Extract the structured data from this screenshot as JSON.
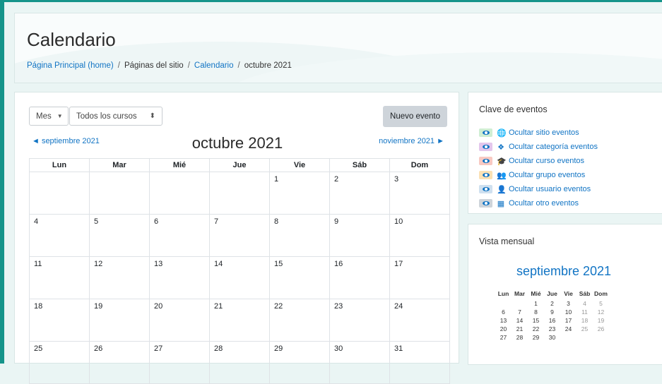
{
  "header": {
    "title": "Calendario",
    "breadcrumb": {
      "home": "Página Principal (home)",
      "sitio": "Páginas del sitio",
      "calendario": "Calendario",
      "current": "octubre 2021",
      "separator": "/"
    }
  },
  "toolbar": {
    "view_select": "Mes",
    "course_select": "Todos los cursos",
    "new_event": "Nuevo evento"
  },
  "calendar": {
    "prev_month": "◄  septiembre 2021",
    "next_month": "noviembre 2021  ►",
    "month_title": "octubre 2021",
    "weekdays": [
      "Lun",
      "Mar",
      "Mié",
      "Jue",
      "Vie",
      "Sáb",
      "Dom"
    ],
    "weeks": [
      [
        "",
        "",
        "",
        "",
        "1",
        "2",
        "3"
      ],
      [
        "4",
        "5",
        "6",
        "7",
        "8",
        "9",
        "10"
      ],
      [
        "11",
        "12",
        "13",
        "14",
        "15",
        "16",
        "17"
      ],
      [
        "18",
        "19",
        "20",
        "21",
        "22",
        "23",
        "24"
      ],
      [
        "25",
        "26",
        "27",
        "28",
        "29",
        "30",
        "31"
      ]
    ]
  },
  "event_key": {
    "title": "Clave de eventos",
    "items": [
      {
        "label": "Ocultar sitio eventos",
        "icon": "globe-icon",
        "glyph": "🌐",
        "color": "#cfeed3"
      },
      {
        "label": "Ocultar categoría eventos",
        "icon": "cubes-icon",
        "glyph": "❖",
        "color": "#e3c6ec"
      },
      {
        "label": "Ocultar curso eventos",
        "icon": "graduation-cap-icon",
        "glyph": "🎓",
        "color": "#f8c9c2"
      },
      {
        "label": "Ocultar grupo eventos",
        "icon": "group-icon",
        "glyph": "👥",
        "color": "#fbe1b4"
      },
      {
        "label": "Ocultar usuario eventos",
        "icon": "user-icon",
        "glyph": "👤",
        "color": "#cfe0ef"
      },
      {
        "label": "Ocultar otro eventos",
        "icon": "calendar-icon",
        "glyph": "▦",
        "color": "#ced4da"
      }
    ]
  },
  "mini_calendar": {
    "section_title": "Vista mensual",
    "month_title": "septiembre 2021",
    "weekdays": [
      "Lun",
      "Mar",
      "Mié",
      "Jue",
      "Vie",
      "Sáb",
      "Dom"
    ],
    "weeks": [
      [
        "",
        "",
        "1",
        "2",
        "3",
        "4",
        "5"
      ],
      [
        "6",
        "7",
        "8",
        "9",
        "10",
        "11",
        "12"
      ],
      [
        "13",
        "14",
        "15",
        "16",
        "17",
        "18",
        "19"
      ],
      [
        "20",
        "21",
        "22",
        "23",
        "24",
        "25",
        "26"
      ],
      [
        "27",
        "28",
        "29",
        "30",
        "",
        "",
        ""
      ]
    ]
  }
}
